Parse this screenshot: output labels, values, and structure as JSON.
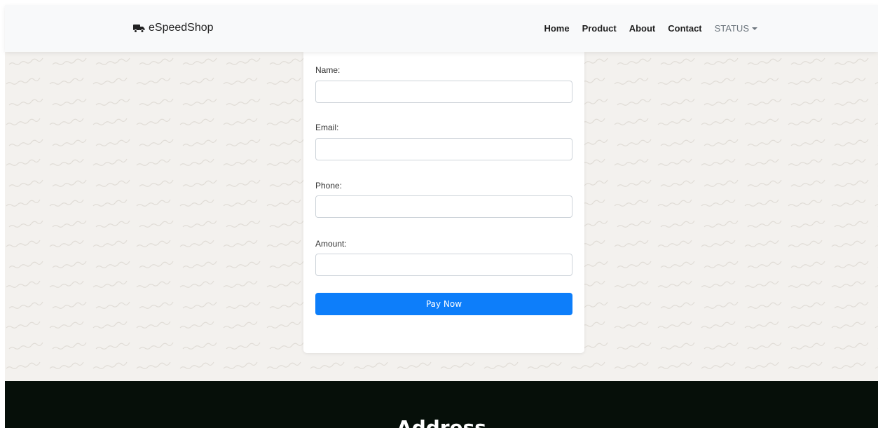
{
  "navbar": {
    "brand": "eSpeedShop",
    "brand_icon": "truck-icon",
    "links": [
      "Home",
      "Product",
      "About",
      "Contact"
    ],
    "status_label": "STATUS"
  },
  "form": {
    "name_label": "Name:",
    "email_label": "Email:",
    "phone_label": "Phone:",
    "amount_label": "Amount:",
    "name_value": "",
    "email_value": "",
    "phone_value": "",
    "amount_value": "",
    "pay_label": "Pay Now"
  },
  "footer": {
    "title": "Address"
  },
  "colors": {
    "accent": "#0d7efa",
    "footer_bg": "#060f09",
    "navbar_bg": "#f8f9fa"
  }
}
